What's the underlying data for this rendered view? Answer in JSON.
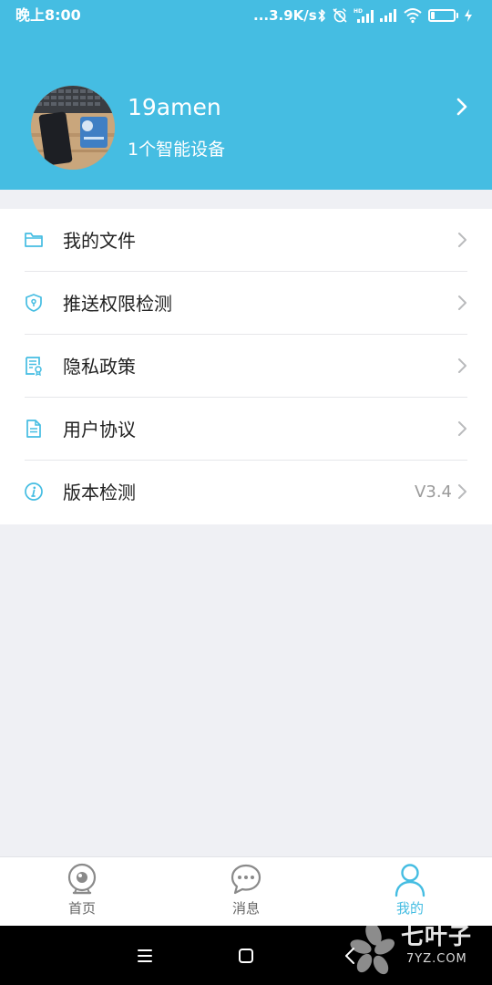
{
  "status_bar": {
    "time": "晚上8:00",
    "network_speed": "...3.9K/s",
    "battery_level": "19",
    "battery_percent": 19,
    "icons": [
      "bluetooth-icon",
      "alarm-off-icon",
      "hd-signal-icon",
      "signal-icon",
      "wifi-icon",
      "battery-icon",
      "charging-icon"
    ]
  },
  "profile": {
    "username": "19amen",
    "device_count": "1个智能设备",
    "header_color": "#45bde2"
  },
  "menu": {
    "items": [
      {
        "label": "我的文件",
        "value": "",
        "icon": "folder-icon"
      },
      {
        "label": "推送权限检测",
        "value": "",
        "icon": "shield-icon"
      },
      {
        "label": "隐私政策",
        "value": "",
        "icon": "certificate-icon"
      },
      {
        "label": "用户协议",
        "value": "",
        "icon": "document-icon"
      },
      {
        "label": "版本检测",
        "value": "V3.4",
        "icon": "info-icon"
      }
    ]
  },
  "tabs": {
    "items": [
      {
        "label": "首页",
        "icon": "camera-icon",
        "active": false
      },
      {
        "label": "消息",
        "icon": "message-icon",
        "active": false
      },
      {
        "label": "我的",
        "icon": "person-icon",
        "active": true
      }
    ],
    "active_color": "#45bde2"
  },
  "nav_bar": {
    "buttons": [
      "menu-icon",
      "home-icon",
      "back-icon"
    ]
  },
  "watermark": {
    "brand": "七叶子",
    "domain": "7YZ.COM"
  }
}
